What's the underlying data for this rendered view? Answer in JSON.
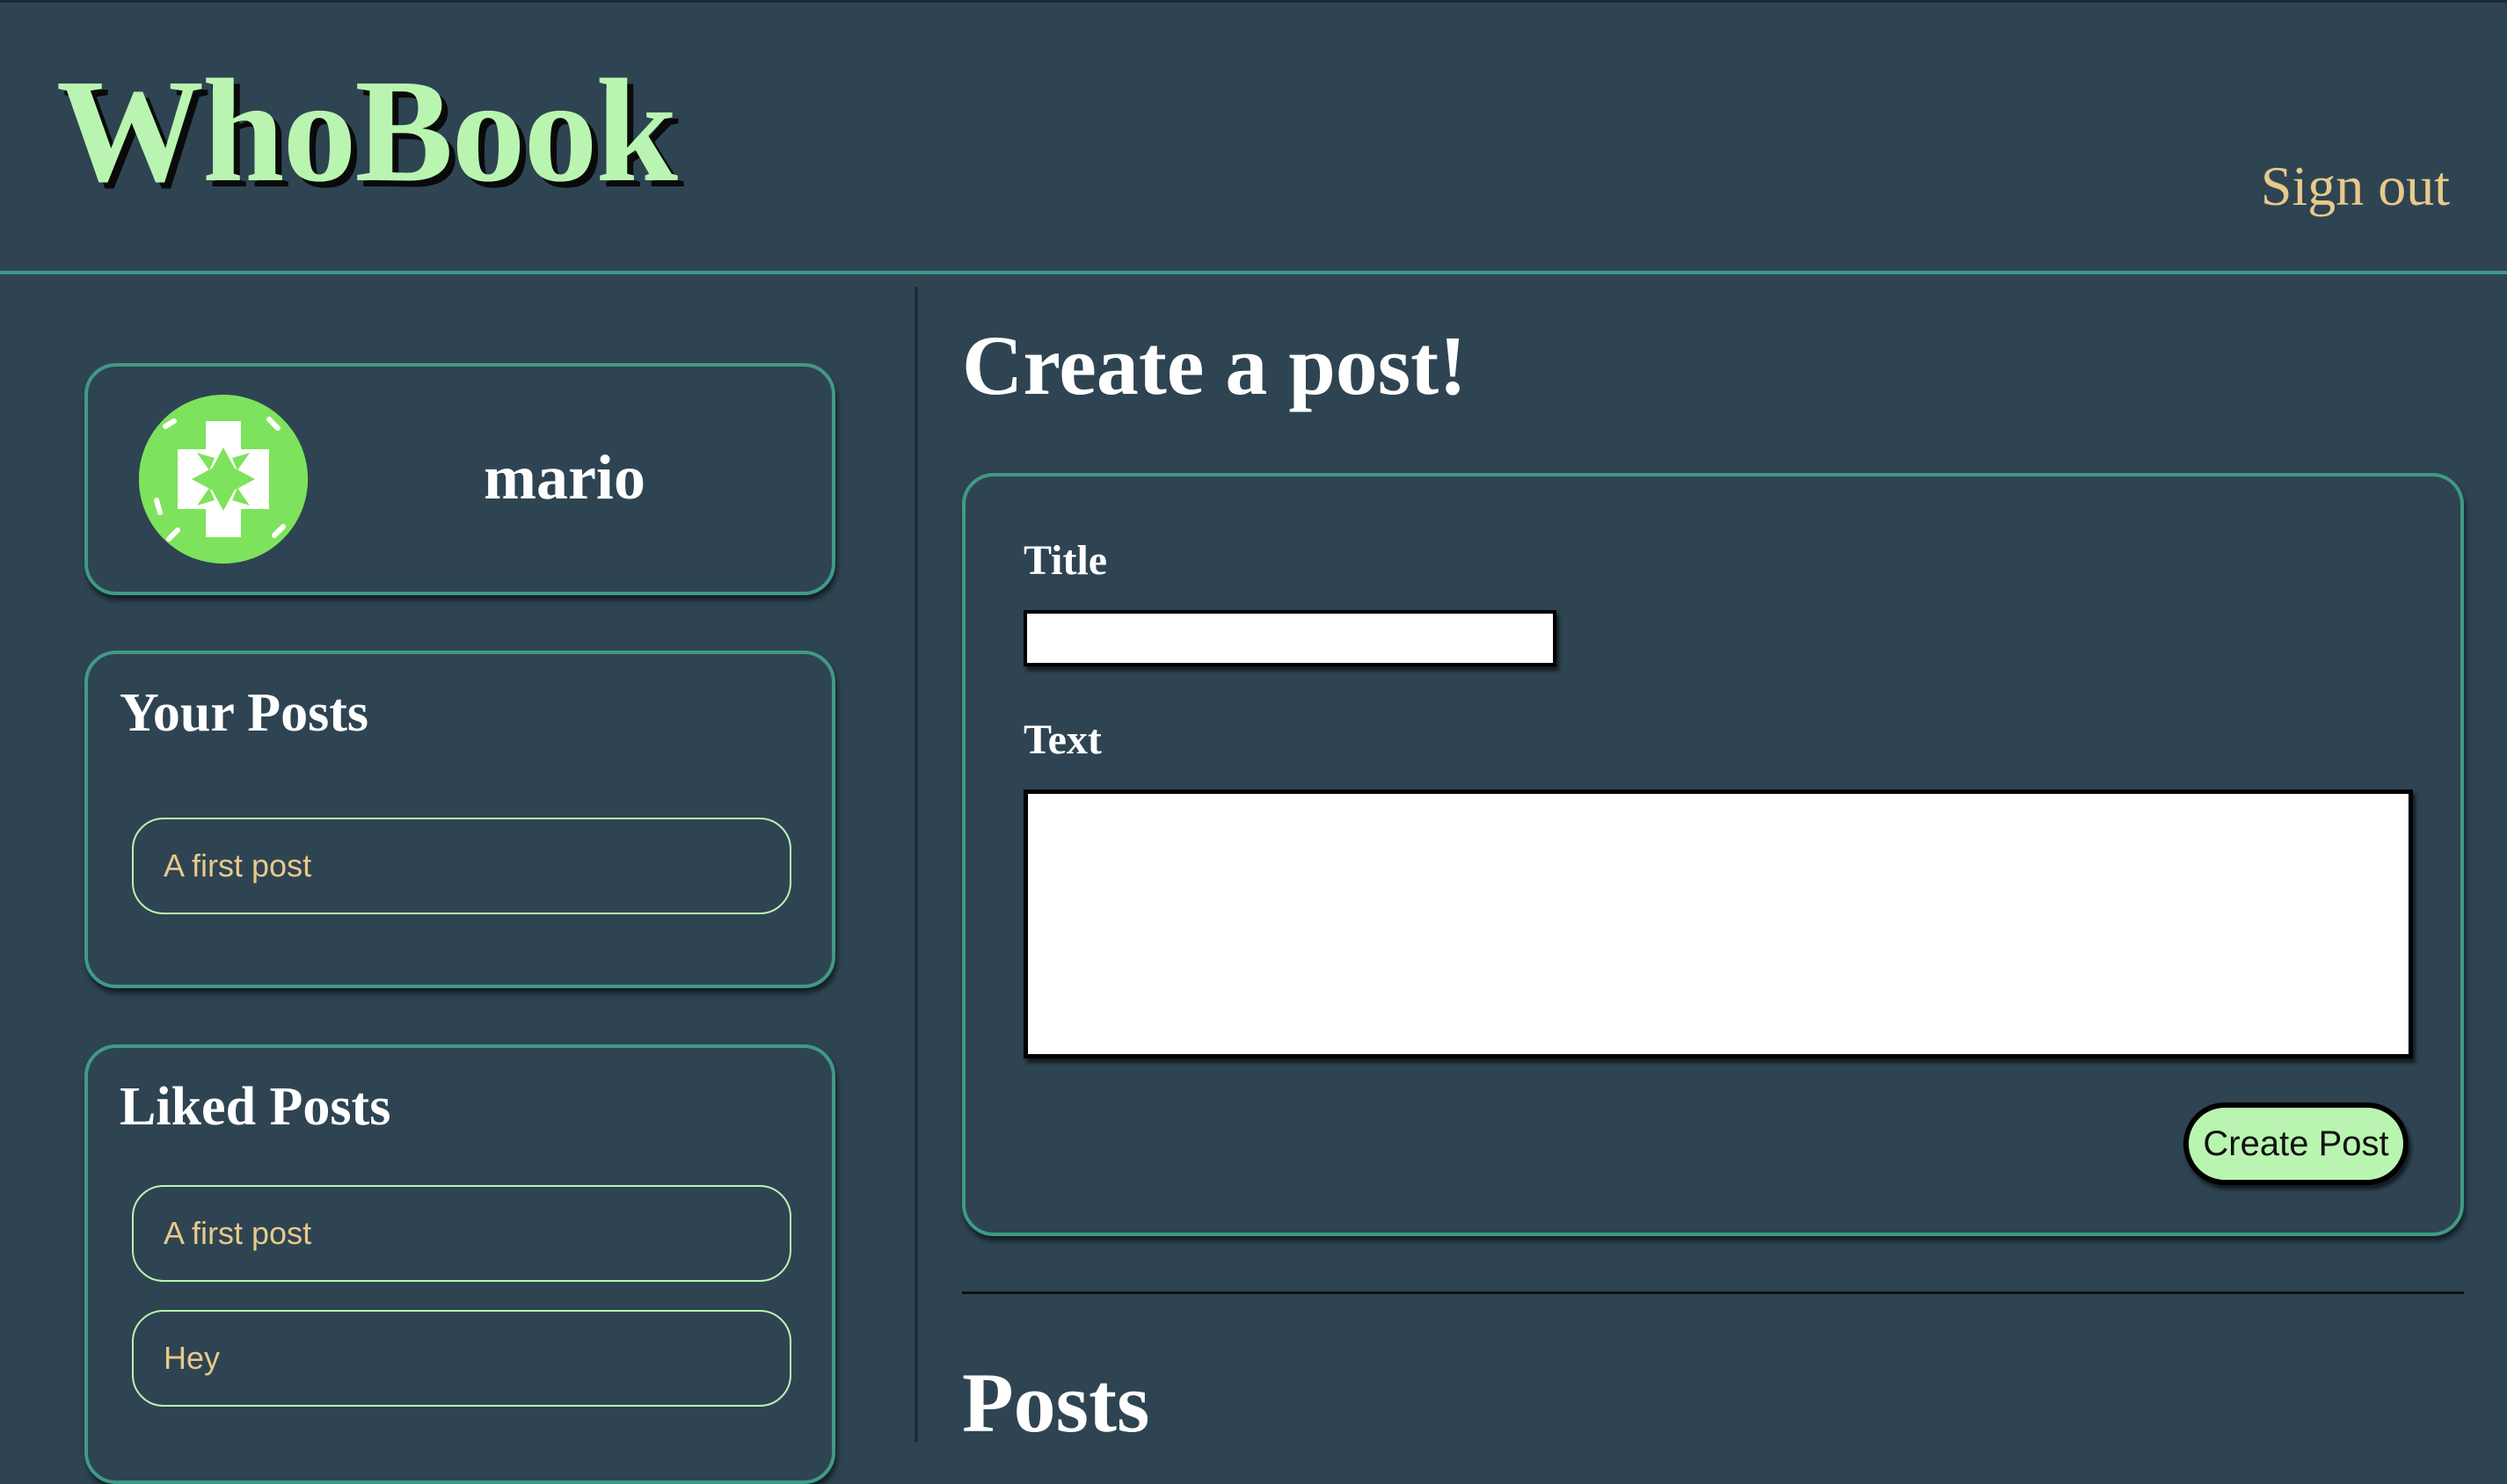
{
  "app": {
    "logo": "WhoBook",
    "sign_out_label": "Sign out"
  },
  "sidebar": {
    "profile": {
      "username": "mario",
      "avatar_icon": "identicon-avatar"
    },
    "your_posts": {
      "title": "Your Posts",
      "items": [
        "A first post"
      ]
    },
    "liked_posts": {
      "title": "Liked Posts",
      "items": [
        "A first post",
        "Hey"
      ]
    }
  },
  "main": {
    "create_heading": "Create a post!",
    "form": {
      "title_label": "Title",
      "title_value": "",
      "text_label": "Text",
      "text_value": "",
      "submit_label": "Create Post"
    },
    "posts_heading": "Posts"
  },
  "colors": {
    "background": "#2e4452",
    "accent_green": "#b9f5b0",
    "border_teal": "#3f9a86",
    "link_gold": "#e8c98a",
    "avatar_green": "#7ee35c"
  }
}
